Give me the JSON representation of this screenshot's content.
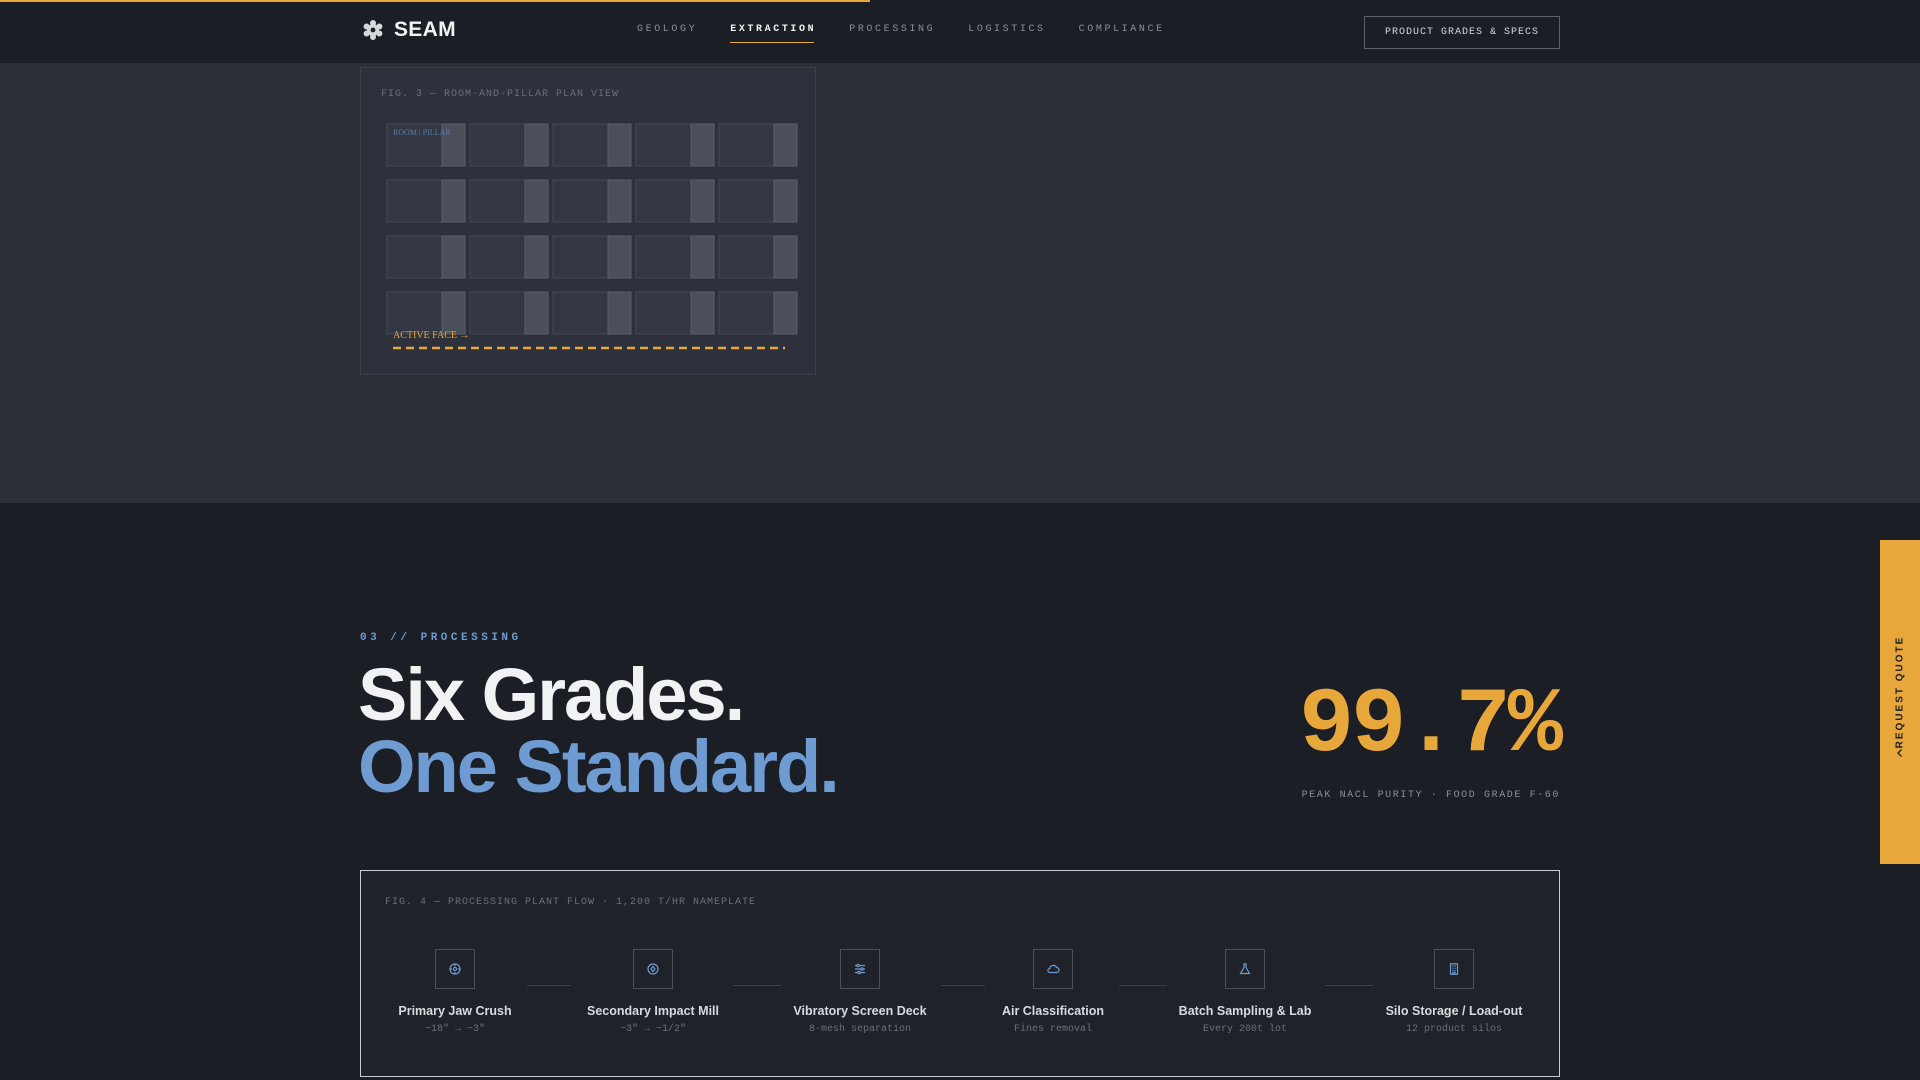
{
  "nav": {
    "brand": "SEAM",
    "links": [
      {
        "label": "GEOLOGY",
        "active": false
      },
      {
        "label": "EXTRACTION",
        "active": true
      },
      {
        "label": "PROCESSING",
        "active": false
      },
      {
        "label": "LOGISTICS",
        "active": false
      },
      {
        "label": "COMPLIANCE",
        "active": false
      }
    ],
    "cta": "PRODUCT GRADES & SPECS"
  },
  "fig3": {
    "label": "FIG. 3 — ROOM-AND-PILLAR PLAN VIEW",
    "room_label": "ROOM | PILLAR",
    "face_label": "ACTIVE FACE →"
  },
  "processing": {
    "section_label": "03 // PROCESSING",
    "headline_line1": "Six Grades.",
    "headline_line2": "One Standard.",
    "stat_value": "99.7%",
    "stat_caption": "PEAK NACL PURITY · FOOD GRADE F-60"
  },
  "fig4": {
    "label": "FIG. 4 — PROCESSING PLANT FLOW · 1,200 T/HR NAMEPLATE",
    "steps": [
      {
        "title": "Primary Jaw Crush",
        "sub": "~18\" → ~3\"",
        "icon": "crusher-icon"
      },
      {
        "title": "Secondary Impact Mill",
        "sub": "~3\" → ~1/2\"",
        "icon": "mill-icon"
      },
      {
        "title": "Vibratory Screen Deck",
        "sub": "8-mesh separation",
        "icon": "sliders-icon"
      },
      {
        "title": "Air Classification",
        "sub": "Fines removal",
        "icon": "cloud-icon"
      },
      {
        "title": "Batch Sampling & Lab",
        "sub": "Every 200t lot",
        "icon": "flask-icon"
      },
      {
        "title": "Silo Storage / Load-out",
        "sub": "12 product silos",
        "icon": "building-icon"
      }
    ]
  },
  "side_tab": {
    "label": "REQUEST QUOTE",
    "icon": "chevron-left-icon"
  },
  "colors": {
    "accent": "#e8a73a",
    "blue": "#6e9bd1",
    "bg_dark": "#1b1e25",
    "bg_section": "#2b2f38"
  }
}
